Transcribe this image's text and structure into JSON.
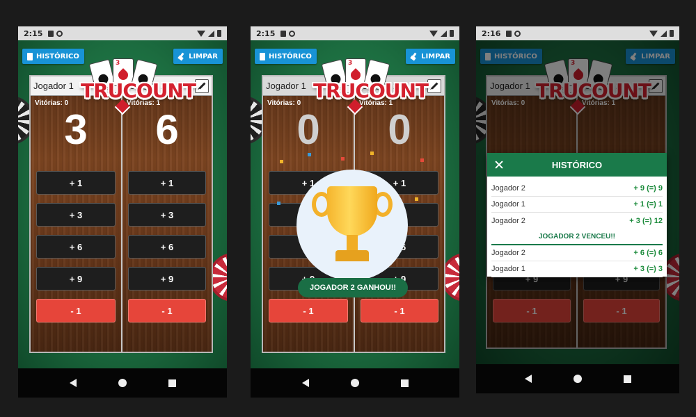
{
  "status": {
    "time_1": "2:15",
    "time_2": "2:15",
    "time_3": "2:16"
  },
  "top_buttons": {
    "history_label": "HISTÓRICO",
    "clear_label": "LIMPAR"
  },
  "logo": {
    "text": "TRUCOUNT",
    "card_rank": "3"
  },
  "players": {
    "p1_name": "Jogador 1",
    "p2_name": "Jogador 2"
  },
  "screen1": {
    "p1_wins": "Vitórias: 0",
    "p2_wins": "Vitórias: 1",
    "p1_score": "3",
    "p2_score": "6"
  },
  "screen2": {
    "p1_wins": "Vitórias: 0",
    "p2_wins": "Vitórias: 1",
    "p1_score": "0",
    "p2_score": "0",
    "winner_toast": "JOGADOR 2 GANHOU!!"
  },
  "screen3": {
    "p1_wins": "Vitórias: 0",
    "p2_wins": "Vitórias: 1"
  },
  "score_buttons": [
    "+ 1",
    "+ 3",
    "+ 6",
    "+ 9",
    "- 1"
  ],
  "history_dialog": {
    "title": "HISTÓRICO",
    "rows_before": [
      {
        "player": "Jogador 2",
        "points": "+ 9 (=) 9"
      },
      {
        "player": "Jogador 1",
        "points": "+ 1 (=) 1"
      },
      {
        "player": "Jogador 2",
        "points": "+ 3 (=) 12"
      }
    ],
    "winner_line": "JOGADOR 2 VENCEU!!",
    "rows_after": [
      {
        "player": "Jogador 2",
        "points": "+ 6 (=) 6"
      },
      {
        "player": "Jogador 1",
        "points": "+ 3 (=) 3"
      }
    ]
  },
  "colors": {
    "accent_blue": "#1893d6",
    "felt_green": "#1c6d40",
    "negative_red": "#e6453a",
    "history_green": "#1a7a4a"
  }
}
